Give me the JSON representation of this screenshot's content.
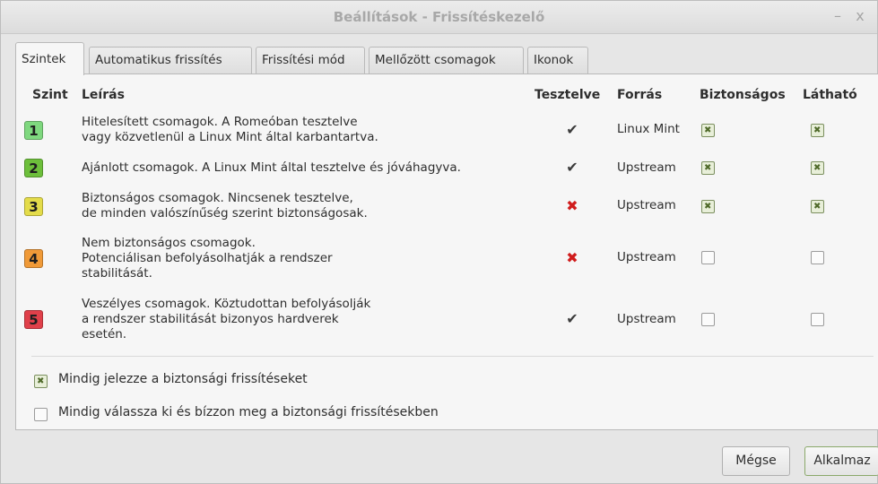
{
  "window": {
    "title": "Beállítások - Frissítéskezelő",
    "minimize_glyph": "–",
    "close_glyph": "x"
  },
  "tabs": [
    {
      "label": "Szintek",
      "active": true
    },
    {
      "label": "Automatikus frissítés"
    },
    {
      "label": "Frissítési mód"
    },
    {
      "label": "Mellőzött csomagok"
    },
    {
      "label": "Ikonok"
    }
  ],
  "table": {
    "headers": {
      "level": "Szint",
      "description": "Leírás",
      "tested": "Tesztelve",
      "source": "Forrás",
      "safe": "Biztonságos",
      "visible": "Látható"
    },
    "rows": [
      {
        "level": "1",
        "color": "#7fd87f",
        "description": "Hitelesített csomagok. A Romeóban tesztelve\nvagy közvetlenül a Linux Mint által karbantartva.",
        "tested": "✔",
        "tested_ok": true,
        "source": "Linux Mint",
        "safe": true,
        "visible": true
      },
      {
        "level": "2",
        "color": "#6dbf3b",
        "description": "Ajánlott csomagok. A Linux Mint által tesztelve és jóváhagyva.",
        "tested": "✔",
        "tested_ok": true,
        "source": "Upstream",
        "safe": true,
        "visible": true
      },
      {
        "level": "3",
        "color": "#e4dc4a",
        "description": "Biztonságos csomagok. Nincsenek tesztelve,\nde minden valószínűség szerint biztonságosak.",
        "tested": "✖",
        "tested_ok": false,
        "source": "Upstream",
        "safe": true,
        "visible": true
      },
      {
        "level": "4",
        "color": "#f09a38",
        "description": "Nem biztonságos csomagok.\nPotenciálisan befolyásolhatják a rendszer\nstabilitását.",
        "tested": "✖",
        "tested_ok": false,
        "source": "Upstream",
        "safe": false,
        "visible": false
      },
      {
        "level": "5",
        "color": "#e0404a",
        "description": "Veszélyes csomagok. Köztudottan befolyásolják\na rendszer stabilitását bizonyos hardverek\nesetén.",
        "tested": "✔",
        "tested_ok": true,
        "source": "Upstream",
        "safe": false,
        "visible": false
      }
    ]
  },
  "options": [
    {
      "label": "Mindig jelezze a biztonsági frissítéseket",
      "checked": true
    },
    {
      "label": "Mindig válassza ki és bízzon meg a biztonsági frissítésekben",
      "checked": false
    }
  ],
  "buttons": {
    "cancel": "Mégse",
    "apply": "Alkalmaz"
  }
}
